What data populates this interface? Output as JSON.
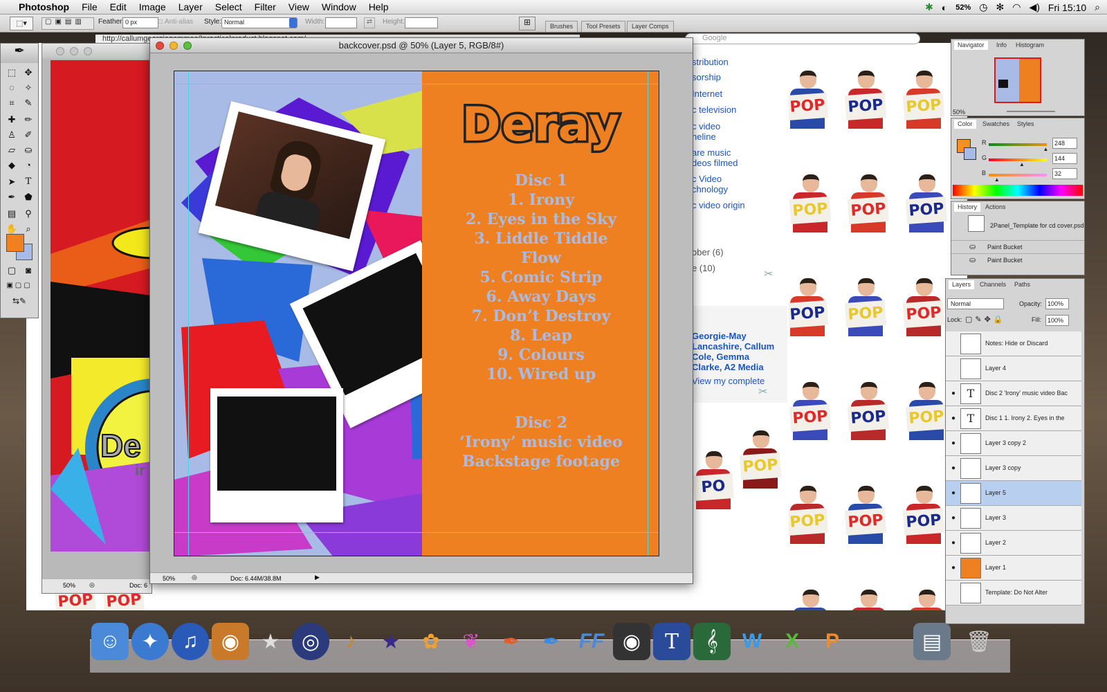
{
  "menubar": {
    "app_name": "Photoshop",
    "menus": [
      "File",
      "Edit",
      "Image",
      "Layer",
      "Select",
      "Filter",
      "View",
      "Window",
      "Help"
    ],
    "battery": "52%",
    "clock": "Fri 15:10"
  },
  "options_bar": {
    "feather_label": "Feather:",
    "feather_value": "0 px",
    "anti_alias_label": "Anti-alias",
    "style_label": "Style:",
    "style_value": "Normal",
    "width_label": "Width:",
    "height_label": "Height:",
    "well_tabs": [
      "Brushes",
      "Tool Presets",
      "Layer Comps"
    ]
  },
  "browser": {
    "url": "http://callumgeorgiegemmaa2practicalproduct.blogspot.com/",
    "search_placeholder": "Google"
  },
  "document": {
    "title": "backcover.psd @ 50% (Layer 5, RGB/8#)",
    "zoom": "50%",
    "doc_size": "Doc: 6.44M/38.8M"
  },
  "left_document": {
    "zoom": "50%",
    "doc_label": "Doc: 6",
    "text": "De",
    "subtext": "ir"
  },
  "cover": {
    "band_name": "Deray",
    "disc1_heading": "Disc 1",
    "tracks": [
      "1. Irony",
      "2. Eyes in the Sky",
      "3. Liddle Tiddle",
      "Flow",
      "5. Comic Strip",
      "6. Away Days",
      "7. Don’t Destroy",
      "8. Leap",
      "9. Colours",
      "10. Wired up"
    ],
    "disc2_heading": "Disc 2",
    "disc2_lines": [
      "‘Irony’ music video",
      "Backstage footage"
    ]
  },
  "blog": {
    "links": [
      "stribution",
      "sorship",
      "Internet",
      "c television",
      "c video",
      "neline",
      "are music",
      "deos filmed",
      "c Video",
      "chnology",
      "c video origin",
      "ober (6)",
      "e (10)"
    ],
    "author": [
      "Georgie-May",
      "Lancashire, Callum",
      "Cole, Gemma",
      "Clarke, A2 Media"
    ],
    "profile_link": "View my complete",
    "pop_sign": "POP",
    "pop_sign_partial": "PO"
  },
  "navigator": {
    "tabs": [
      "Navigator",
      "Info",
      "Histogram"
    ],
    "zoom": "50%"
  },
  "color_panel": {
    "tabs": [
      "Color",
      "Swatches",
      "Styles"
    ],
    "channels": [
      {
        "label": "R",
        "value": "248"
      },
      {
        "label": "G",
        "value": "144"
      },
      {
        "label": "B",
        "value": "32"
      }
    ],
    "r_level": 0.97,
    "g_level": 0.56,
    "b_level": 0.13,
    "foreground": "#f89020"
  },
  "history_panel": {
    "tabs": [
      "History",
      "Actions"
    ],
    "snapshot": "2Panel_Template for cd cover.psd",
    "items": [
      "Paint Bucket",
      "Paint Bucket"
    ]
  },
  "layers_panel": {
    "tabs": [
      "Layers",
      "Channels",
      "Paths"
    ],
    "blend_mode": "Normal",
    "opacity_label": "Opacity:",
    "opacity_value": "100%",
    "lock_label": "Lock:",
    "fill_label": "Fill:",
    "fill_value": "100%",
    "layers": [
      {
        "name": "Notes: Hide or Discard",
        "visible": false,
        "type": "img",
        "selected": false
      },
      {
        "name": "Layer 4",
        "visible": false,
        "type": "img",
        "selected": false
      },
      {
        "name": "Disc 2 'Irony' music video Bac",
        "visible": true,
        "type": "text",
        "selected": false
      },
      {
        "name": "Disc 1 1. Irony 2. Eyes in the",
        "visible": true,
        "type": "text",
        "selected": false
      },
      {
        "name": "Layer 3 copy 2",
        "visible": true,
        "type": "img",
        "selected": false
      },
      {
        "name": "Layer 3 copy",
        "visible": true,
        "type": "img",
        "selected": false
      },
      {
        "name": "Layer 5",
        "visible": true,
        "type": "img",
        "selected": true
      },
      {
        "name": "Layer 3",
        "visible": true,
        "type": "img",
        "selected": false
      },
      {
        "name": "Layer 2",
        "visible": true,
        "type": "img",
        "selected": false
      },
      {
        "name": "Layer 1",
        "visible": true,
        "type": "img",
        "selected": false
      },
      {
        "name": "Template: Do Not Alter",
        "visible": false,
        "type": "img",
        "selected": false
      }
    ]
  },
  "icons": {
    "text_tool": "T",
    "text_layer": "T",
    "eye": "●"
  }
}
